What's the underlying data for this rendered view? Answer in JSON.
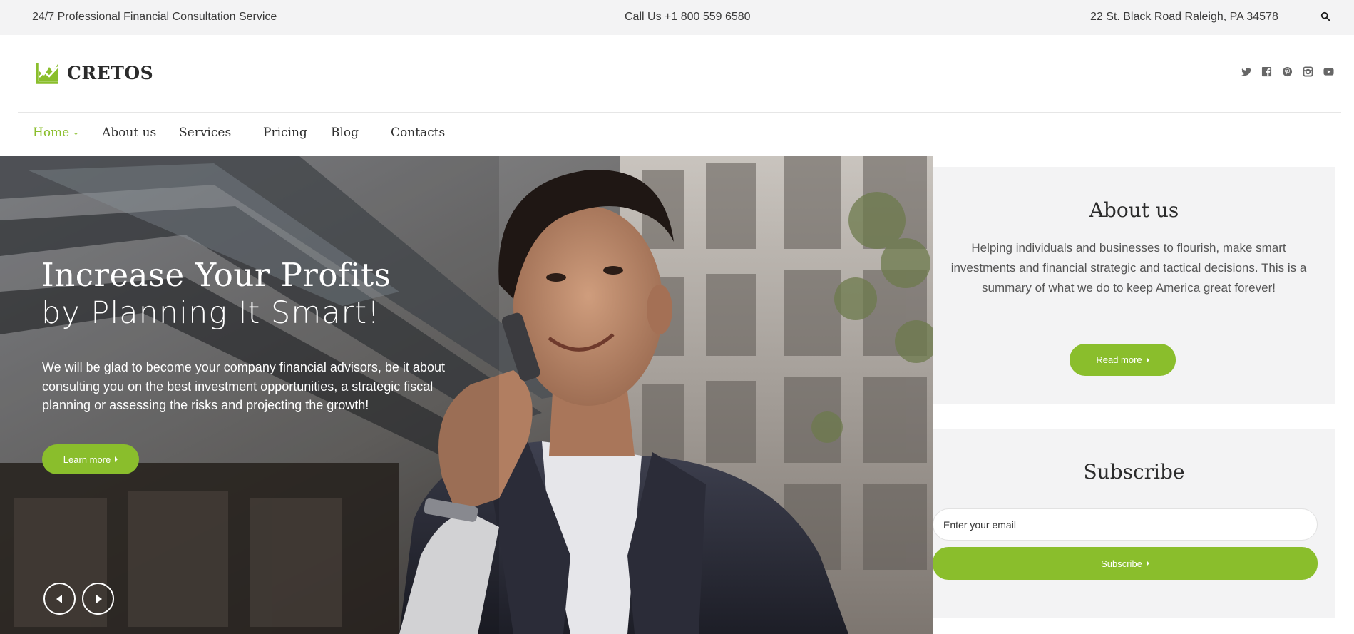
{
  "topbar": {
    "tagline": "24/7 Professional Financial Consultation Service",
    "phone": "Call Us +1 800 559 6580",
    "address": "22 St. Black Road Raleigh, PA 34578",
    "search_icon": "search-icon"
  },
  "brand": {
    "name": "CRETOS",
    "logo_icon": "chart-logo-icon",
    "accent_color": "#8abe2c"
  },
  "socials": [
    "twitter-icon",
    "facebook-icon",
    "pinterest-icon",
    "instagram-icon",
    "youtube-icon"
  ],
  "nav": {
    "items": [
      {
        "label": "Home",
        "active": true
      },
      {
        "label": "About us"
      },
      {
        "label": "Services"
      },
      {
        "label": "Pricing"
      },
      {
        "label": "Blog"
      },
      {
        "label": "Contacts"
      }
    ]
  },
  "hero": {
    "title_line1": "Increase Your Profits",
    "title_line2": "by Planning It Smart!",
    "text": "We will be glad to become your company financial advisors, be it about consulting you on the best investment opportunities, a strategic fiscal planning or assessing the risks and projecting the growth!",
    "button_label": "Learn more",
    "prev_icon": "arrow-left-icon",
    "next_icon": "arrow-right-icon"
  },
  "about": {
    "title": "About us",
    "text": "Helping individuals and businesses to flourish, make smart investments and financial strategic and tactical decisions. This is a summary of what we do to keep America great forever!",
    "button_label": "Read more"
  },
  "subscribe": {
    "title": "Subscribe",
    "placeholder": "Enter your email",
    "button_label": "Subscribe"
  }
}
